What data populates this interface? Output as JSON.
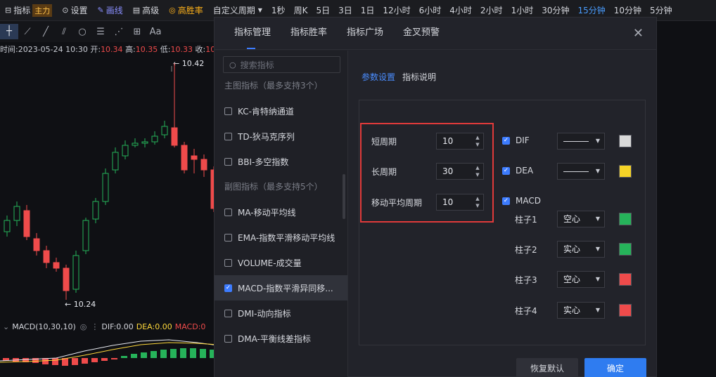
{
  "toolbar": {
    "indicator_label": "指标",
    "main_badge": "主力",
    "settings_label": "设置",
    "draw_label": "画线",
    "advanced_label": "高级",
    "high_win_label": "高胜率",
    "custom_period_label": "自定义周期",
    "periods": [
      {
        "label": "1秒",
        "active": false
      },
      {
        "label": "周K",
        "active": false
      },
      {
        "label": "5日",
        "active": false
      },
      {
        "label": "3日",
        "active": false
      },
      {
        "label": "1日",
        "active": false
      },
      {
        "label": "12小时",
        "active": false
      },
      {
        "label": "6小时",
        "active": false
      },
      {
        "label": "4小时",
        "active": false
      },
      {
        "label": "2小时",
        "active": false
      },
      {
        "label": "1小时",
        "active": false
      },
      {
        "label": "30分钟",
        "active": false
      },
      {
        "label": "15分钟",
        "active": true
      },
      {
        "label": "10分钟",
        "active": false
      },
      {
        "label": "5分钟",
        "active": false
      }
    ]
  },
  "drawbar": {
    "font_tool": "Aa"
  },
  "quote": {
    "time_label": "时间:",
    "time": "2023-05-24 10:30",
    "open_label": "开:",
    "open": "10.34",
    "high_label": "高:",
    "high": "10.35",
    "low_label": "低:",
    "low": "10.33",
    "close_label": "收:",
    "close": "10"
  },
  "chart": {
    "high_marker": "← 10.42",
    "low_marker": "← 10.24",
    "colors": {
      "up": "#26b35a",
      "down": "#ef4b4b",
      "dif": "#e8eaf0",
      "dea": "#ffd93b"
    }
  },
  "macd_legend": {
    "name": "MACD(10,30,10)",
    "dif": "DIF:0.00",
    "dea": "DEA:0.00",
    "macd": "MACD:0"
  },
  "modal": {
    "tabs": [
      "指标管理",
      "指标胜率",
      "指标广场",
      "金叉预警"
    ],
    "active_tab": 0,
    "search_placeholder": "搜索指标",
    "main_group_title": "主图指标（最多支持3个）",
    "sub_group_title": "副图指标（最多支持5个）",
    "main_indicators": [
      {
        "label": "KC-肯特纳通道",
        "checked": false
      },
      {
        "label": "TD-狄马克序列",
        "checked": false
      },
      {
        "label": "BBI-多空指数",
        "checked": false
      }
    ],
    "sub_indicators": [
      {
        "label": "MA-移动平均线",
        "checked": false
      },
      {
        "label": "EMA-指数平滑移动平均线",
        "checked": false
      },
      {
        "label": "VOLUME-成交量",
        "checked": false
      },
      {
        "label": "MACD-指数平滑异同移...",
        "checked": true
      },
      {
        "label": "DMI-动向指标",
        "checked": false
      },
      {
        "label": "DMA-平衡线差指标",
        "checked": false
      }
    ],
    "subtabs": [
      "参数设置",
      "指标说明"
    ],
    "params": [
      {
        "label": "短周期",
        "value": "10"
      },
      {
        "label": "长周期",
        "value": "30"
      },
      {
        "label": "移动平均周期",
        "value": "10"
      }
    ],
    "lines": [
      {
        "label": "DIF",
        "checked": true,
        "color": "#d9d9d9"
      },
      {
        "label": "DEA",
        "checked": true,
        "color": "#f5d327"
      }
    ],
    "macd_label": "MACD",
    "bars": [
      {
        "label": "柱子1",
        "style": "空心",
        "color": "#26b35a"
      },
      {
        "label": "柱子2",
        "style": "实心",
        "color": "#26b35a"
      },
      {
        "label": "柱子3",
        "style": "空心",
        "color": "#ef4b4b"
      },
      {
        "label": "柱子4",
        "style": "实心",
        "color": "#ef4b4b"
      }
    ],
    "reset_label": "恢复默认",
    "confirm_label": "确定"
  }
}
